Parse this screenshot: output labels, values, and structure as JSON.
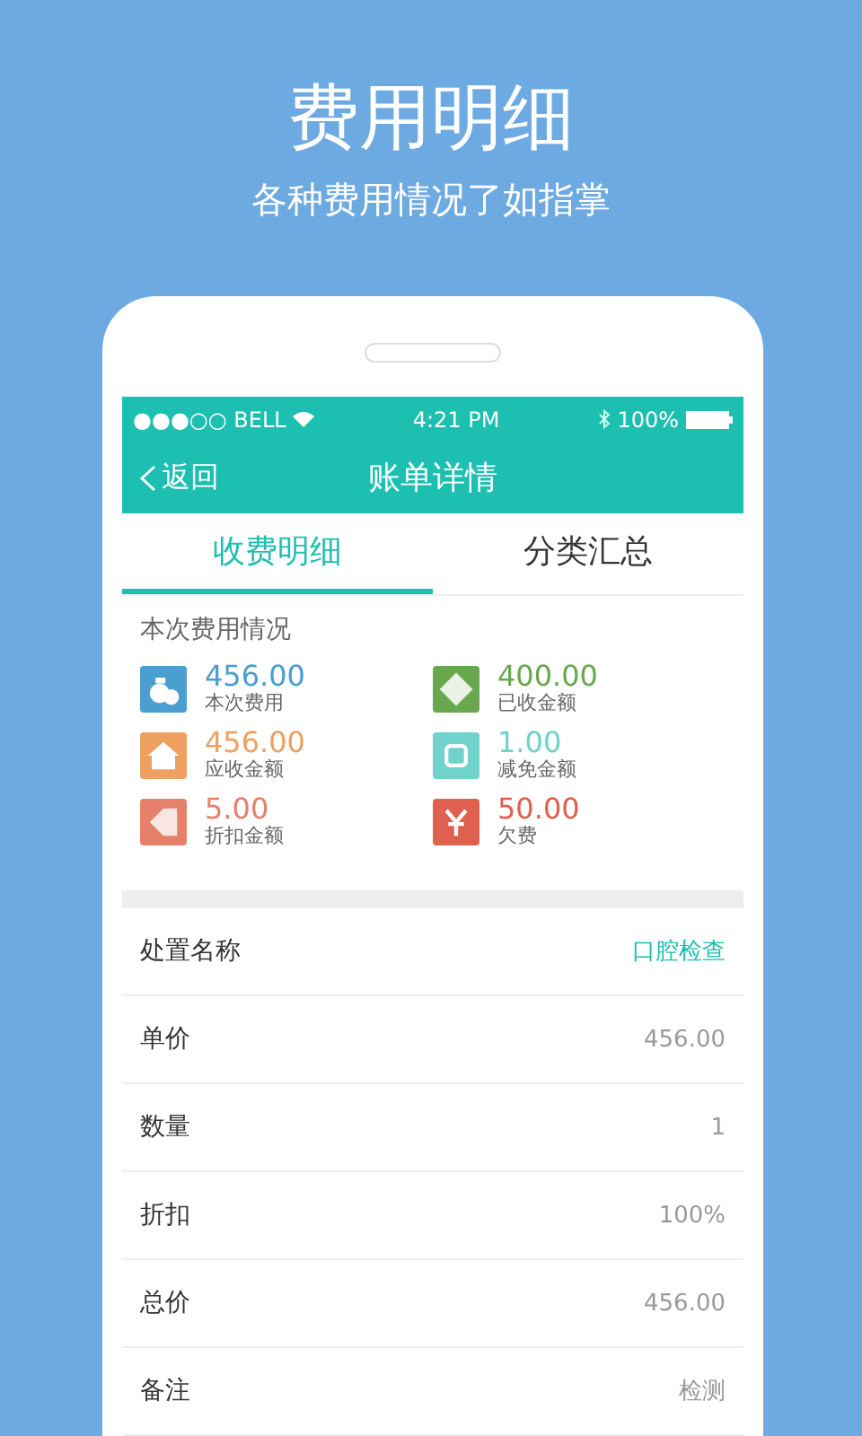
{
  "headline": "费用明细",
  "subheadline": "各种费用情况了如指掌",
  "status_bar": {
    "carrier": "●●●○○ BELL",
    "time": "4:21 PM",
    "battery": "100%"
  },
  "nav": {
    "back": "返回",
    "title": "账单详情"
  },
  "tabs": [
    {
      "label": "收费明细",
      "selected": true
    },
    {
      "label": "分类汇总",
      "selected": false
    }
  ],
  "summary": {
    "title": "本次费用情况",
    "items": [
      {
        "amount": "456.00",
        "label": "本次费用",
        "color": "#4a9fd0"
      },
      {
        "amount": "400.00",
        "label": "已收金额",
        "color": "#6aa84f"
      },
      {
        "amount": "456.00",
        "label": "应收金额",
        "color": "#eda060"
      },
      {
        "amount": "1.00",
        "label": "减免金额",
        "color": "#6fd3cb"
      },
      {
        "amount": "5.00",
        "label": "折扣金额",
        "color": "#e6806a"
      },
      {
        "amount": "50.00",
        "label": "欠费",
        "color": "#e0604f"
      }
    ]
  },
  "rows": [
    {
      "label": "处置名称",
      "value": "口腔检查",
      "kind": "link"
    },
    {
      "label": "单价",
      "value": "456.00",
      "kind": "text"
    },
    {
      "label": "数量",
      "value": "1",
      "kind": "text"
    },
    {
      "label": "折扣",
      "value": "100%",
      "kind": "text"
    },
    {
      "label": "总价",
      "value": "456.00",
      "kind": "text"
    },
    {
      "label": "备注",
      "value": "检测",
      "kind": "text"
    }
  ]
}
